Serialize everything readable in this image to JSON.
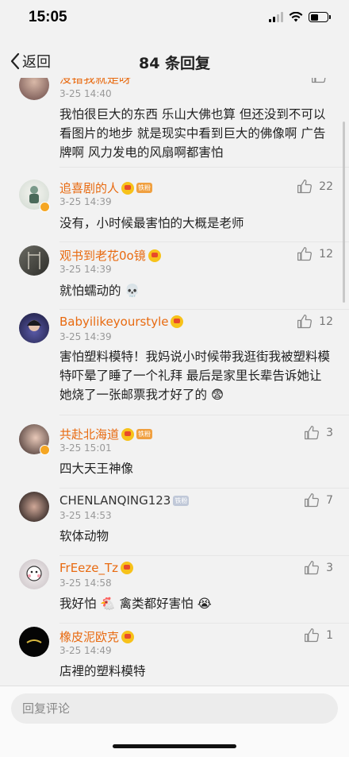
{
  "status": {
    "time": "15:05"
  },
  "nav": {
    "back_label": "返回",
    "title": "84 条回复"
  },
  "comments": [
    {
      "name": "没错我就是呀",
      "time": "3-25 14:40",
      "content": "我怕很巨大的东西  乐山大佛也算  但还没到不可以看图片的地步  就是现实中看到巨大的佛像啊  广告牌啊  风力发电的风扇啊都害怕",
      "likes": ""
    },
    {
      "name": "追喜剧的人",
      "fan": "铁粉",
      "time": "3-25 14:39",
      "content": "没有，小时候最害怕的大概是老师",
      "likes": "22"
    },
    {
      "name": "观书到老花0o镜",
      "time": "3-25 14:39",
      "content": "就怕蠕动的 💀",
      "likes": "12"
    },
    {
      "name": "Babyilikeyourstyle",
      "time": "3-25 14:39",
      "content": "害怕塑料模特！我妈说小时候带我逛街我被塑料模特吓晕了睡了一个礼拜 最后是家里长辈告诉她让她烧了一张邮票我才好了的 😨",
      "likes": "12"
    },
    {
      "name": "共赴北海道",
      "fan": "铁粉",
      "time": "3-25 15:01",
      "content": "四大天王神像",
      "likes": "3"
    },
    {
      "name": "CHENLANQING123",
      "fan": "铁粉",
      "time": "3-25 14:53",
      "content": "软体动物",
      "likes": "7"
    },
    {
      "name": "FrEeze_Tz",
      "time": "3-25 14:58",
      "content": "我好怕 🐔 禽类都好害怕 😭",
      "likes": "3"
    },
    {
      "name": "橡皮泥欧克",
      "time": "3-25 14:49",
      "content": "店裡的塑料模特",
      "likes": "1"
    }
  ],
  "reply": {
    "placeholder": "回复评论"
  },
  "icons": [
    "back-chevron-icon",
    "thumb-up-icon",
    "signal-icon",
    "wifi-icon",
    "battery-icon"
  ],
  "colors": {
    "username": "#e86a10",
    "background": "#f2f2f2"
  }
}
